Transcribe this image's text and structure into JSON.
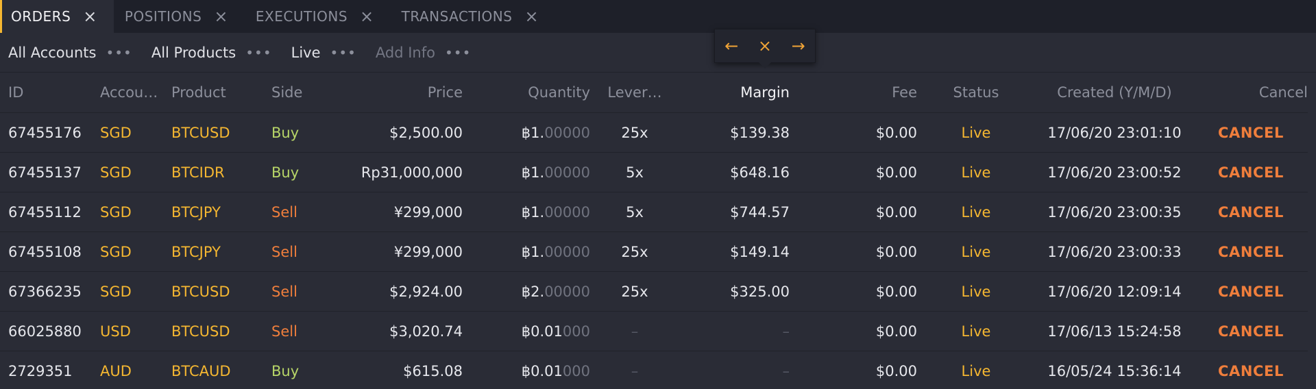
{
  "tabs": [
    {
      "label": "ORDERS",
      "active": true
    },
    {
      "label": "POSITIONS",
      "active": false
    },
    {
      "label": "EXECUTIONS",
      "active": false
    },
    {
      "label": "TRANSACTIONS",
      "active": false
    }
  ],
  "icons": {
    "close": "×",
    "more": "•••",
    "left_arrow": "←",
    "right_arrow": "→"
  },
  "filters": [
    {
      "label": "All Accounts"
    },
    {
      "label": "All Products"
    },
    {
      "label": "Live"
    },
    {
      "label": "Add Info"
    }
  ],
  "columns": {
    "id": "ID",
    "account": "Accou…",
    "product": "Product",
    "side": "Side",
    "price": "Price",
    "quantity": "Quantity",
    "leverage": "Lever…",
    "margin": "Margin",
    "fee": "Fee",
    "status": "Status",
    "created": "Created (Y/M/D)",
    "cancel": "Cancel"
  },
  "rows": [
    {
      "id": "67455176",
      "account": "SGD",
      "product": "BTCUSD",
      "side": "Buy",
      "price": "$2,500.00",
      "qty_main": "฿1.",
      "qty_dim": "00000",
      "leverage": "25x",
      "margin": "$139.38",
      "fee": "$0.00",
      "status": "Live",
      "created": "17/06/20 23:01:10",
      "cancel": "CANCEL"
    },
    {
      "id": "67455137",
      "account": "SGD",
      "product": "BTCIDR",
      "side": "Buy",
      "price": "Rp31,000,000",
      "qty_main": "฿1.",
      "qty_dim": "00000",
      "leverage": "5x",
      "margin": "$648.16",
      "fee": "$0.00",
      "status": "Live",
      "created": "17/06/20 23:00:52",
      "cancel": "CANCEL"
    },
    {
      "id": "67455112",
      "account": "SGD",
      "product": "BTCJPY",
      "side": "Sell",
      "price": "¥299,000",
      "qty_main": "฿1.",
      "qty_dim": "00000",
      "leverage": "5x",
      "margin": "$744.57",
      "fee": "$0.00",
      "status": "Live",
      "created": "17/06/20 23:00:35",
      "cancel": "CANCEL"
    },
    {
      "id": "67455108",
      "account": "SGD",
      "product": "BTCJPY",
      "side": "Sell",
      "price": "¥299,000",
      "qty_main": "฿1.",
      "qty_dim": "00000",
      "leverage": "25x",
      "margin": "$149.14",
      "fee": "$0.00",
      "status": "Live",
      "created": "17/06/20 23:00:33",
      "cancel": "CANCEL"
    },
    {
      "id": "67366235",
      "account": "SGD",
      "product": "BTCUSD",
      "side": "Sell",
      "price": "$2,924.00",
      "qty_main": "฿2.",
      "qty_dim": "00000",
      "leverage": "25x",
      "margin": "$325.00",
      "fee": "$0.00",
      "status": "Live",
      "created": "17/06/20 12:09:14",
      "cancel": "CANCEL"
    },
    {
      "id": "66025880",
      "account": "USD",
      "product": "BTCUSD",
      "side": "Sell",
      "price": "$3,020.74",
      "qty_main": "฿0.01",
      "qty_dim": "000",
      "leverage": "–",
      "margin": "–",
      "fee": "$0.00",
      "status": "Live",
      "created": "17/06/13 15:24:58",
      "cancel": "CANCEL"
    },
    {
      "id": "2729351",
      "account": "AUD",
      "product": "BTCAUD",
      "side": "Buy",
      "price": "$615.08",
      "qty_main": "฿0.01",
      "qty_dim": "000",
      "leverage": "–",
      "margin": "–",
      "fee": "$0.00",
      "status": "Live",
      "created": "16/05/24 15:36:14",
      "cancel": "CANCEL"
    }
  ],
  "colors": {
    "accent": "#f5b731",
    "buy": "#b7d568",
    "sell": "#ef7e3c",
    "background": "#2a2c36",
    "tabbar": "#1e2029"
  }
}
